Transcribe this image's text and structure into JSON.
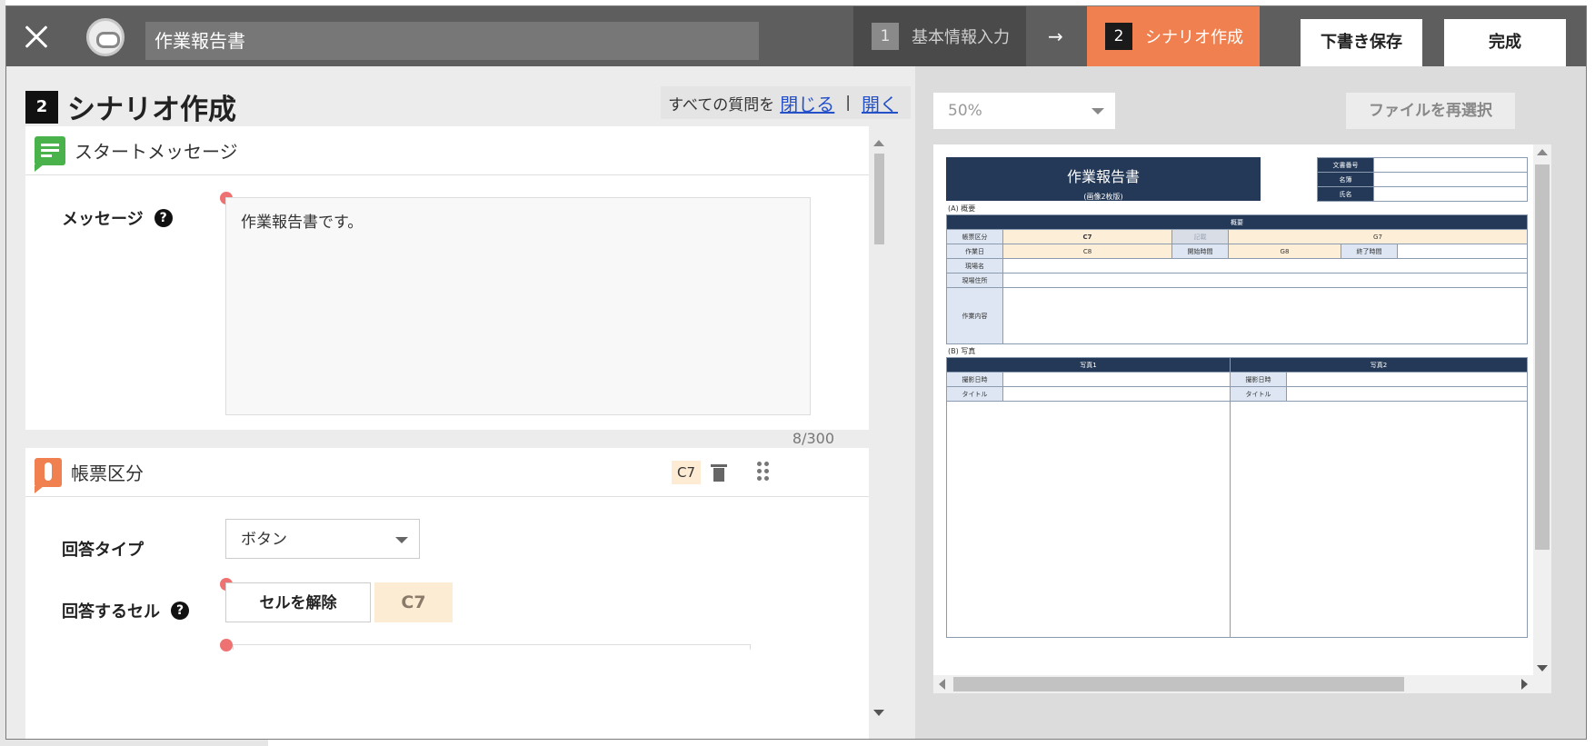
{
  "header": {
    "title_value": "作業報告書",
    "steps": [
      {
        "num": "1",
        "label": "基本情報入力"
      },
      {
        "num": "2",
        "label": "シナリオ作成"
      }
    ],
    "save_label": "下書き保存",
    "done_label": "完成",
    "accent_color": "#f0804f"
  },
  "section": {
    "num": "2",
    "title": "シナリオ作成",
    "toggle_prefix": "すべての質問を",
    "close_all": "閉じる",
    "separator": "|",
    "open_all": "開く"
  },
  "card_start": {
    "title": "スタートメッセージ",
    "message_label": "メッセージ",
    "message_value": "作業報告書です。",
    "counter": "8/300"
  },
  "card_form_type": {
    "title": "帳票区分",
    "cell_badge": "C7",
    "answer_type_label": "回答タイプ",
    "answer_type_value": "ボタン",
    "answer_cell_label": "回答するセル",
    "release_label": "セルを解除",
    "cell_value": "C7"
  },
  "preview": {
    "zoom_value": "50%",
    "reselect_label": "ファイルを再選択",
    "sheet": {
      "title": "作業報告書",
      "subtitle": "(画像2枚版)",
      "docinfo": [
        "文書番号",
        "名簿",
        "氏名"
      ],
      "section_a": "(A) 概要",
      "overview_bar": "概要",
      "row1": [
        "帳票区分",
        "C7",
        "記載",
        "G7"
      ],
      "row2": [
        "作業日",
        "C8",
        "開始時間",
        "G8",
        "終了時間"
      ],
      "site_name": "現場名",
      "site_address": "現場住所",
      "work_content": "作業内容",
      "section_b": "(B) 写真",
      "photo1": "写真1",
      "photo2": "写真2",
      "shot_date": "撮影日時",
      "photo_title": "タイトル"
    }
  }
}
